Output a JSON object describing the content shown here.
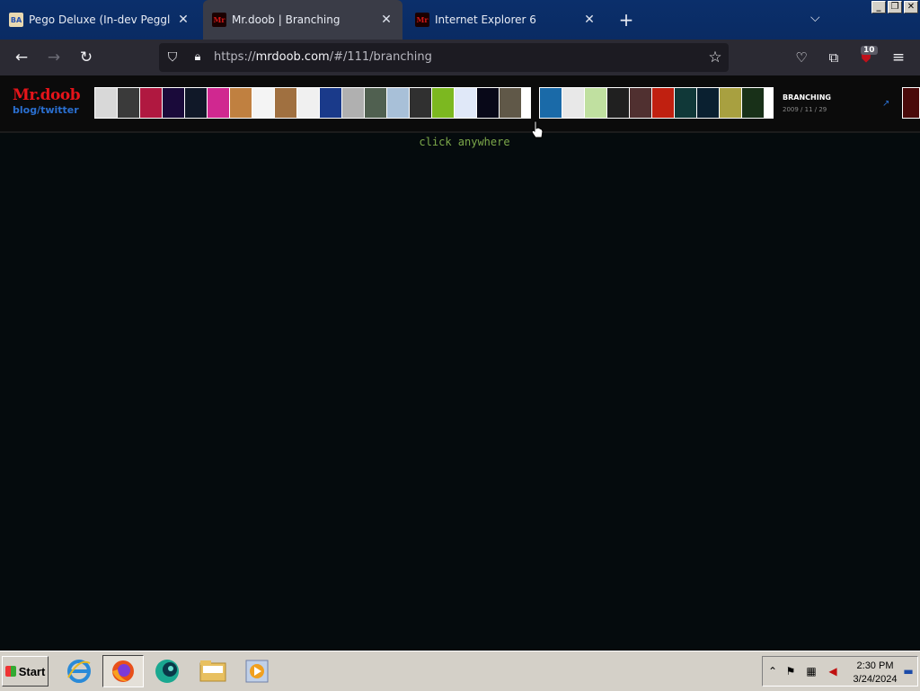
{
  "browser": {
    "tabs": [
      {
        "title": "Pego Deluxe (In-dev Peggle Deluxe",
        "favicon": "BA",
        "active": false
      },
      {
        "title": "Mr.doob | Branching",
        "favicon": "Mr",
        "active": true
      },
      {
        "title": "Internet Explorer 6",
        "favicon": "Mr",
        "active": false
      }
    ],
    "url_scheme": "https://",
    "url_host": "mrdoob.com",
    "url_path": "/#/111/branching",
    "extension_badge": "10",
    "window_buttons": {
      "minimize": "_",
      "restore": "❐",
      "close": "✕"
    }
  },
  "site": {
    "logo_name": "Mr.doob",
    "logo_sub": "blog/twitter",
    "demo_title": "BRANCHING",
    "demo_date": "2009 / 11 / 29",
    "hint": "click anywhere",
    "strip1_colors": [
      "#d8d8d8",
      "#3a3a3a",
      "#b01840",
      "#1a0a3a",
      "#101828",
      "#d02890",
      "#c08040",
      "#f4f4f4",
      "#a07040",
      "#f0f0f0",
      "#1a3a8a",
      "#b0b0b0",
      "#506050",
      "#a8c0d8",
      "#303030",
      "#7cb820",
      "#e0e8f8",
      "#080818",
      "#605848"
    ],
    "strip2_colors": [
      "#1a6aa8",
      "#e8e8e8",
      "#c0e0a0",
      "#202020",
      "#503030",
      "#c02010",
      "#103838",
      "#0a2030",
      "#a8a040",
      "#183018"
    ]
  },
  "taskbar": {
    "start_label": "Start",
    "time": "2:30 PM",
    "date": "3/24/2024"
  }
}
